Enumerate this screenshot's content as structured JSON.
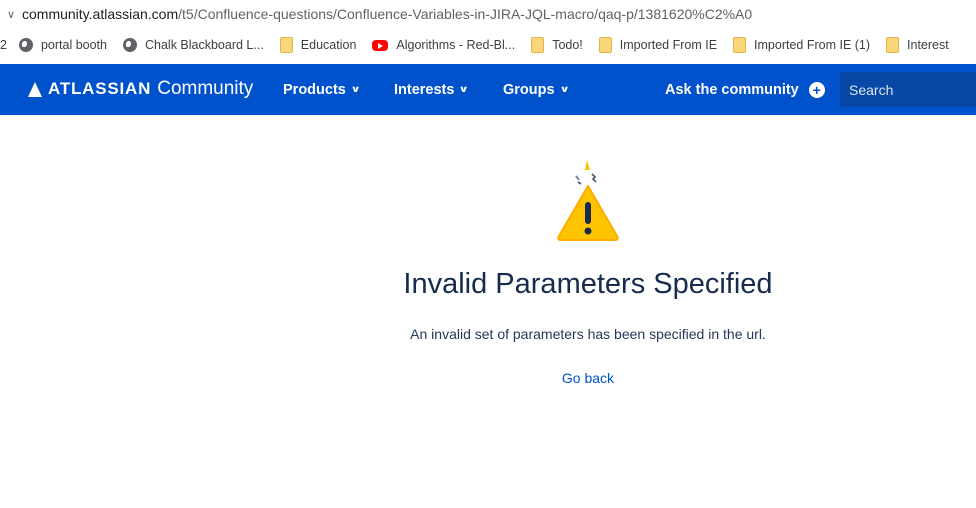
{
  "browser": {
    "url_domain": "community.atlassian.com",
    "url_path": "/t5/Confluence-questions/Confluence-Variables-in-JIRA-JQL-macro/qaq-p/1381620%C2%A0"
  },
  "bookmarks": {
    "first_fragment": "2",
    "items": [
      {
        "label": "portal booth",
        "icon": "globe-icon"
      },
      {
        "label": "Chalk Blackboard L...",
        "icon": "globe-icon"
      },
      {
        "label": "Education",
        "icon": "folder-icon"
      },
      {
        "label": "Algorithms - Red-Bl...",
        "icon": "youtube-icon"
      },
      {
        "label": "Todo!",
        "icon": "folder-icon"
      },
      {
        "label": "Imported From IE",
        "icon": "folder-icon"
      },
      {
        "label": "Imported From IE (1)",
        "icon": "folder-icon"
      },
      {
        "label": "Interest",
        "icon": "folder-icon"
      }
    ]
  },
  "nav": {
    "brand": "ATLASSIAN",
    "brand_sub": "Community",
    "products": "Products",
    "interests": "Interests",
    "groups": "Groups",
    "ask": "Ask the community",
    "search_placeholder": "Search"
  },
  "error": {
    "title": "Invalid Parameters Specified",
    "message": "An invalid set of parameters has been specified in the url.",
    "go_back": "Go back"
  },
  "colors": {
    "nav_bg": "#0052cc",
    "title": "#172b4d",
    "link": "#0052cc",
    "warning": "#ffc400"
  }
}
